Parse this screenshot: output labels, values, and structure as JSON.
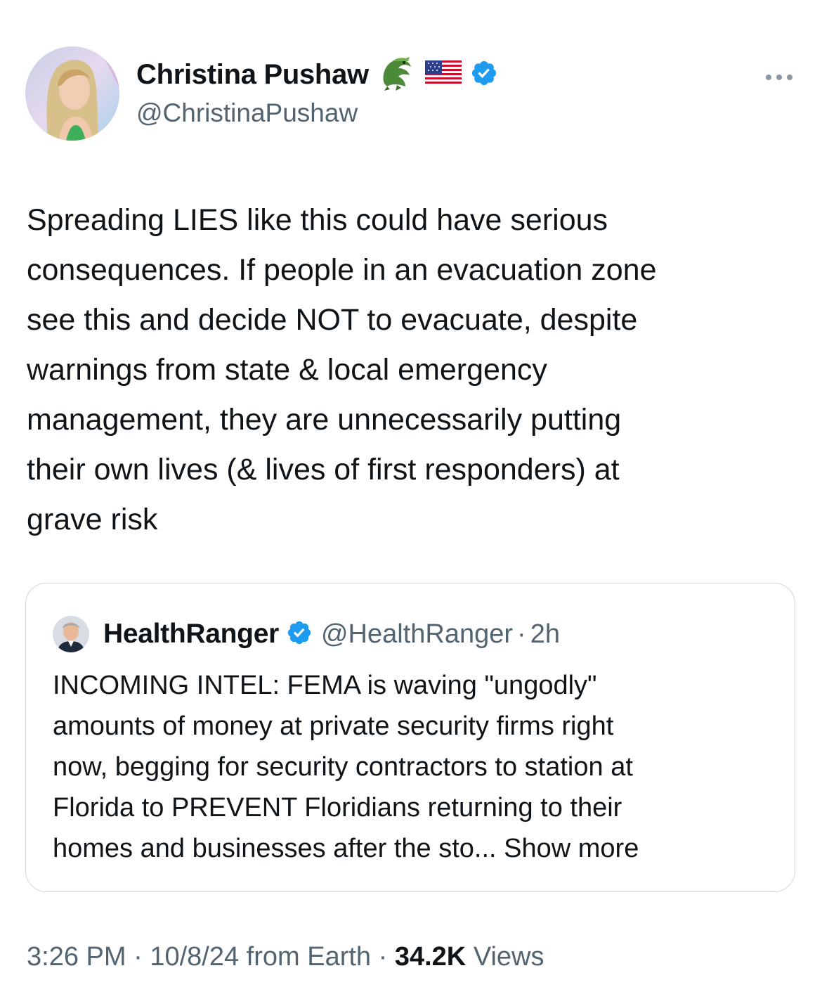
{
  "author": {
    "display_name": "Christina Pushaw",
    "handle": "@ChristinaPushaw",
    "name_emojis": [
      "crocodile-emoji",
      "us-flag-emoji"
    ],
    "verified": true
  },
  "tweet": {
    "text": "Spreading LIES like this could have serious\nconsequences. If people in an evacuation zone\nsee this and decide NOT to evacuate, despite\nwarnings from state & local emergency\nmanagement, they are unnecessarily putting\ntheir own lives (& lives of first responders) at\ngrave risk"
  },
  "quoted_tweet": {
    "display_name": "HealthRanger",
    "handle": "@HealthRanger",
    "separator": "·",
    "time": "2h",
    "verified": true,
    "text": "INCOMING INTEL: FEMA is waving \"ungodly\"\namounts of money at private security firms right\nnow, begging for security contractors to station at\nFlorida to PREVENT Floridians returning to their\nhomes and businesses after the sto... Show more"
  },
  "footer": {
    "time": "3:26 PM",
    "separator": "·",
    "date": "10/8/24",
    "source": "from Earth",
    "views_count": "34.2K",
    "views_label": "Views"
  },
  "colors": {
    "text_primary": "#0f1419",
    "text_secondary": "#536471",
    "verified_blue": "#1d9bf0",
    "border": "#cfd9de"
  },
  "icons": {
    "more": "more-horizontal-icon",
    "verified": "verified-badge-icon"
  }
}
